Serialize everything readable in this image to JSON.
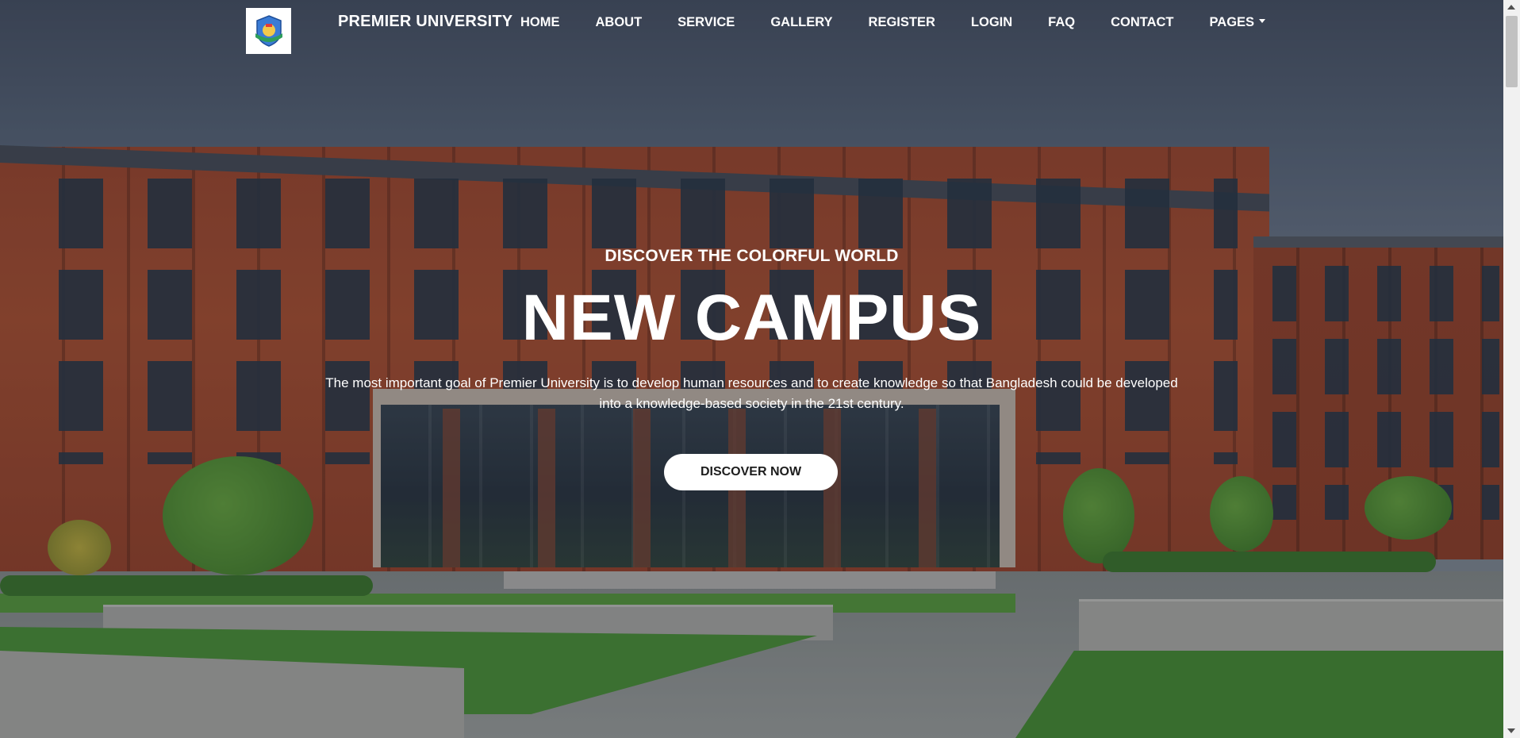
{
  "brand": {
    "name": "PREMIER UNIVERSITY",
    "logo_icon": "university-crest-icon"
  },
  "nav": {
    "items": [
      {
        "label": "HOME"
      },
      {
        "label": "ABOUT"
      },
      {
        "label": "SERVICE"
      },
      {
        "label": "GALLERY"
      },
      {
        "label": "REGISTER"
      },
      {
        "label": "LOGIN"
      },
      {
        "label": "FAQ"
      },
      {
        "label": "CONTACT"
      },
      {
        "label": "PAGES",
        "dropdown_icon": "caret-down-icon"
      }
    ]
  },
  "hero": {
    "kicker": "DISCOVER THE COLORFUL WORLD",
    "headline": "NEW CAMPUS",
    "description": "The most important goal of Premier University is to develop human resources and to create knowledge so that Bangladesh could be developed into a knowledge-based society in the 21st century.",
    "cta_label": "DISCOVER NOW",
    "background": "campus-building-photo"
  },
  "colors": {
    "text": "#ffffff",
    "button_bg": "#ffffff",
    "button_text": "#1d1d1d",
    "brick": "#b5532f",
    "lawn": "#4f9a35"
  }
}
